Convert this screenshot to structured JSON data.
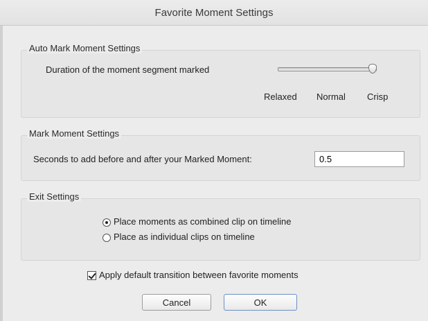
{
  "dialog": {
    "title": "Favorite Moment Settings"
  },
  "auto_mark": {
    "group_label": "Auto Mark Moment Settings",
    "duration_label": "Duration of the moment segment marked",
    "slider_value_fraction": 1.0,
    "scale_labels": [
      "Relaxed",
      "Normal",
      "Crisp"
    ]
  },
  "mark_moment": {
    "group_label": "Mark Moment Settings",
    "seconds_label": "Seconds to add before and after your Marked Moment:",
    "seconds_value": "0.5"
  },
  "exit": {
    "group_label": "Exit Settings",
    "options": [
      {
        "label": "Place moments as combined clip on timeline",
        "selected": true
      },
      {
        "label": "Place as individual clips on timeline",
        "selected": false
      }
    ]
  },
  "apply_transition": {
    "label": "Apply default transition between favorite moments",
    "checked": true
  },
  "buttons": {
    "cancel": "Cancel",
    "ok": "OK"
  }
}
